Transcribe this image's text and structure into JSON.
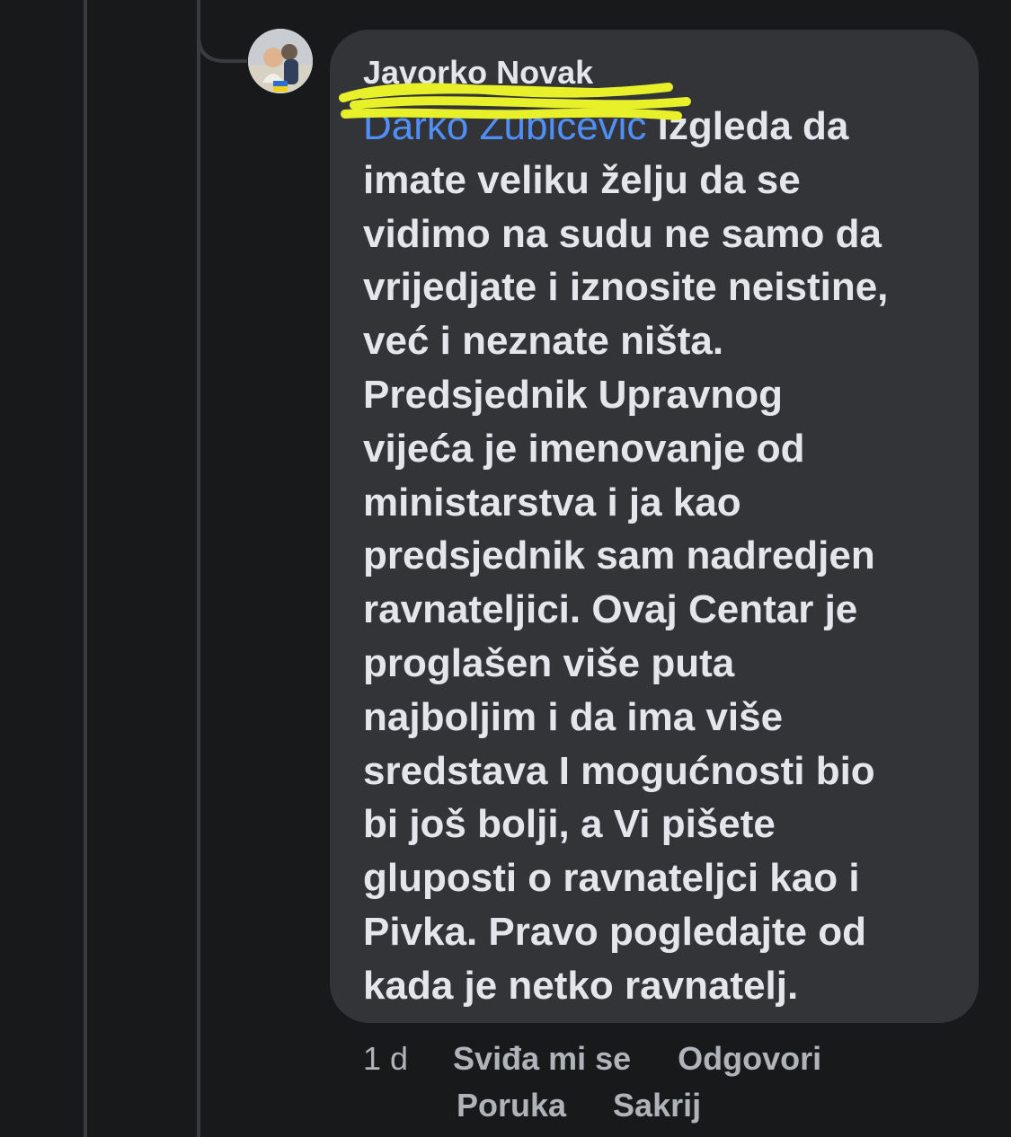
{
  "comment": {
    "author": "Javorko Novak",
    "mention": "Darko Zubičević",
    "lines": [
      " izgleda da",
      "imate veliku želju da se",
      "vidimo na sudu ne samo da",
      "vrijedjate i iznosite neistine,",
      "već i neznate ništa.",
      "Predsjednik Upravnog",
      "vijeća je imenovanje od",
      "ministarstva i ja kao",
      "predsjednik sam nadredjen",
      "ravnateljici. Ovaj Centar je",
      "proglašen više puta",
      "najboljim i da ima više",
      "sredstava I mogućnosti bio",
      "bi još bolji, a Vi pišete",
      "gluposti o ravnateljci kao i",
      "Pivka. Pravo pogledajte od",
      "kada je netko ravnatelj."
    ]
  },
  "actions": {
    "time": "1 d",
    "like": "Sviđa mi se",
    "reply": "Odgovori",
    "message": "Poruka",
    "hide": "Sakrij"
  },
  "colors": {
    "background": "#18191b",
    "bubble": "#333438",
    "text": "#e4e6eb",
    "mention": "#4f8ff7",
    "scribble": "#e8f02a",
    "muted": "#b0b3b8"
  },
  "icons": {
    "avatar": "profile-photo",
    "redaction": "yellow-scribble"
  }
}
